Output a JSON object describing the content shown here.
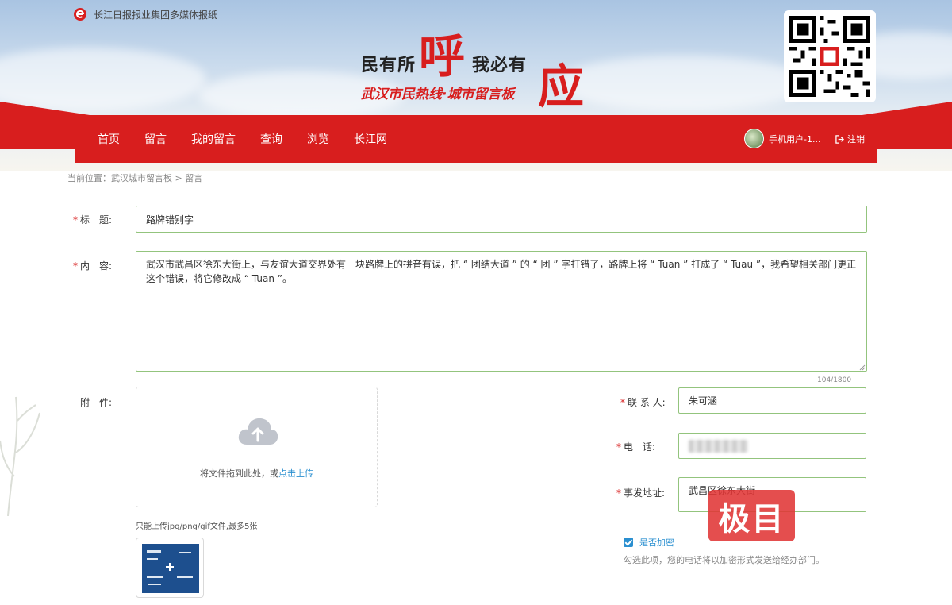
{
  "header": {
    "brand_text": "长江日报报业集团多媒体报纸",
    "banner_left": "民有所",
    "banner_big1": "呼",
    "banner_mid": "我必有",
    "banner_big2": "应",
    "banner_subtitle": "武汉市民热线·城市留言板"
  },
  "nav": {
    "items": [
      "首页",
      "留言",
      "我的留言",
      "查询",
      "浏览",
      "长江网"
    ],
    "user_name": "手机用户-1...",
    "logout_label": "注销"
  },
  "breadcrumb": "当前位置：武汉城市留言板 > 留言",
  "form": {
    "title_label": "标　题:",
    "title_value": "路牌错别字",
    "content_label": "内　容:",
    "content_value": "武汉市武昌区徐东大街上，与友谊大道交界处有一块路牌上的拼音有误，把 “ 团结大道 ” 的 “ 团 ” 字打错了，路牌上将 “ Tuan ” 打成了 “ Tuau ”，我希望相关部门更正这个错误，将它修改成 “ Tuan ”。",
    "char_count": "104/1800",
    "attachment_label": "附　件:",
    "upload_text": "将文件拖到此处，或",
    "upload_link": "点击上传",
    "upload_hint": "只能上传jpg/png/gif文件,最多5张",
    "contact_label": "联 系 人:",
    "contact_value": "朱可涵",
    "phone_label": "电　话:",
    "address_label": "事发地址:",
    "address_value": "武昌区徐东大街",
    "encrypt_label": "是否加密",
    "encrypt_checked": true,
    "encrypt_note": "勾选此项，您的电话将以加密形式发送给经办部门。"
  },
  "watermark": "极目",
  "colors": {
    "brand_red": "#d81e1e",
    "field_border": "#93c47d",
    "link_blue": "#2a8fd0"
  }
}
